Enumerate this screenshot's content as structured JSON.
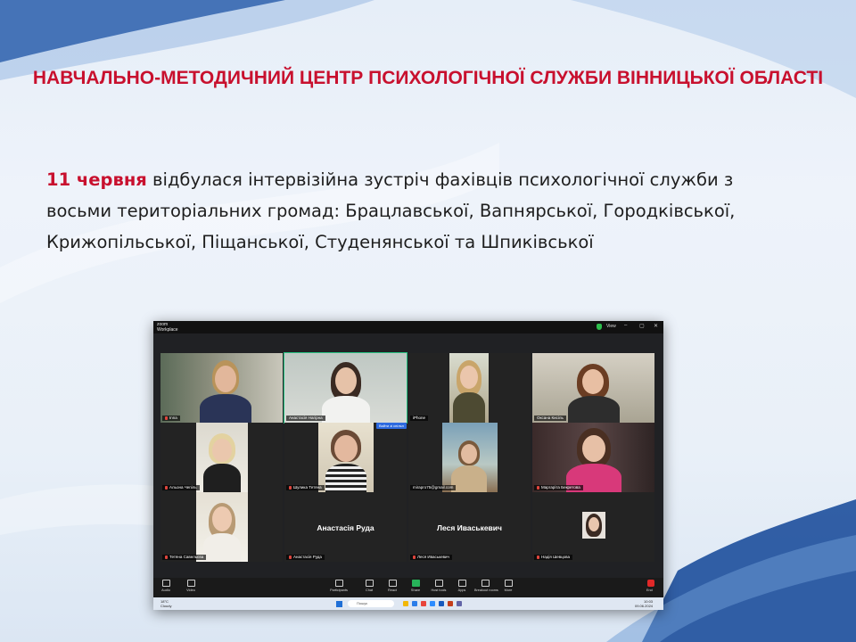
{
  "slide": {
    "title": "НАВЧАЛЬНО-МЕТОДИЧНИЙ ЦЕНТР ПСИХОЛОГІЧНОЇ СЛУЖБИ ВІННИЦЬКОЇ ОБЛАСТІ",
    "date_highlight": "11 червня",
    "body_rest": " відбулася інтервізійна зустріч фахівців психологічної служби з восьми територіальних громад: Брацлавської, Вапнярської, Городківської, Крижопільської, Піщанської, Студенянської та Шпиківської",
    "accent_color": "#c8102e"
  },
  "zoom": {
    "app_brand": "zoom",
    "app_name": "Workplace",
    "view_label": "View",
    "minimize_icon": "–",
    "maximize_icon": "▢",
    "close_icon": "✕",
    "pip_button": "Вийти зі спільн",
    "tiles": [
      {
        "name": "Inna"
      },
      {
        "name": "Анастасія Нагірна"
      },
      {
        "name": "iPhone"
      },
      {
        "name": "Оксана Кисіль"
      },
      {
        "name": "Альона Чепіль"
      },
      {
        "name": "Шулика Тетяна"
      },
      {
        "name": "mirapro75@gmail.com"
      },
      {
        "name": "Маргаріта Бекретова"
      },
      {
        "name": "Тетяна Савельєва"
      },
      {
        "name": "Анастасія Руда",
        "big": "Анастасія Руда"
      },
      {
        "name": "Леся Иваськевич",
        "big": "Леся Иваськевич"
      },
      {
        "name": "Надія Шевцова"
      }
    ],
    "toolbar": {
      "audio": "Audio",
      "video": "Video",
      "participants": "Participants",
      "chat": "Chat",
      "react": "React",
      "share": "Share",
      "host_tools": "Host tools",
      "apps": "Apps",
      "breakout": "Breakout rooms",
      "more": "More",
      "end": "End"
    },
    "participants_count": "12"
  },
  "taskbar": {
    "weather_temp": "18°C",
    "weather_desc": "Cloudy",
    "search_placeholder": "Пошук",
    "time": "10:03",
    "date": "09.06.2024"
  }
}
